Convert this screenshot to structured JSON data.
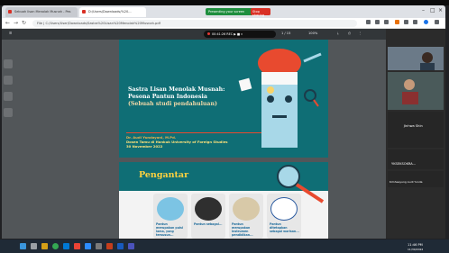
{
  "browser": {
    "tabs": [
      {
        "label": "Sebuah lisan Menolak Musnah - Pes",
        "active": false
      },
      {
        "label": "D:/Users/Downloads/%20...",
        "active": true
      }
    ],
    "share_banner": "Presenting your screen",
    "stop_label": "Stop sharing",
    "url": "File | C:/Users/User/Downloads/Sastra%20Lisan%20Menolak%20Musnah.pdf"
  },
  "pdf_toolbar": {
    "page_label": "1 / 15",
    "zoom": "100%",
    "recording_label": "00:41:26 REC  ▶  ■  ⏸"
  },
  "slide1": {
    "title_line1": "Sastra Lisan Menolak Musnah:",
    "title_line2": "Pesona Pantun Indonesia",
    "title_line3": "(Sebuah studi pendahuluan)",
    "author": "Dr. Audi Yundayani, M.Pd.",
    "role": "Dosen Tamu di Hankuk University of Foreign Studies",
    "date": "30 November 2022"
  },
  "slide2": {
    "heading": "Pengantar",
    "cards": [
      {
        "text": "Pantun merupakan puisi lama, yang tersusun..."
      },
      {
        "text": "Pantun sebagai..."
      },
      {
        "text": "Pantun merupakan instrumen pendidikan..."
      },
      {
        "text": "Pantun ditetapkan sebagai warisan..."
      }
    ]
  },
  "video": {
    "participants": [
      {
        "name": ""
      },
      {
        "name": "Jinhwa Shin"
      },
      {
        "name": "Jinhwa Shin"
      },
      {
        "name": "YKSEKSOKRA..."
      },
      {
        "name": "Kimheeyung Audi Yunda"
      }
    ]
  },
  "taskbar": {
    "time": "11:46 PM",
    "date": "11/30/2022"
  }
}
